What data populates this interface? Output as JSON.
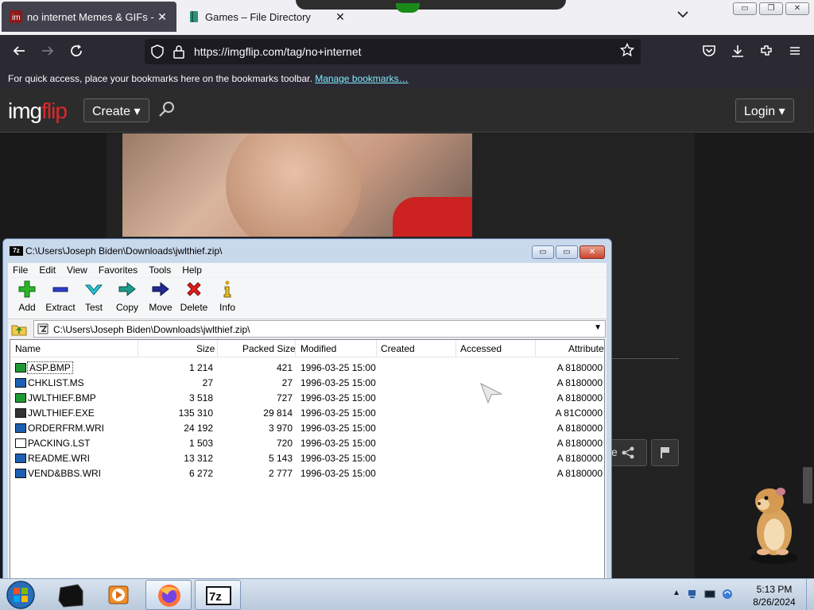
{
  "browser": {
    "tabs": [
      {
        "label": "no internet Memes & GIFs - Im",
        "close": "✕"
      },
      {
        "label": "Games – File Directory",
        "close": "✕"
      }
    ],
    "window_controls": {
      "minimize": "▭",
      "maximize": "❐",
      "close": "✕"
    },
    "url": "https://imgflip.com/tag/no+internet",
    "bookmarks_message": "For quick access, place your bookmarks here on the bookmarks toolbar.",
    "bookmarks_link": "Manage bookmarks…",
    "icons": [
      "back-icon",
      "forward-icon",
      "reload-icon",
      "shield-icon",
      "lock-icon",
      "star-icon",
      "pocket-icon",
      "download-icon",
      "extensions-icon",
      "menu-icon",
      "tab-list-chevron-icon"
    ]
  },
  "site": {
    "logo_white": "img",
    "logo_red": "flip",
    "create_label": "Create ▾",
    "login_label": "Login ▾",
    "share_partial": "e"
  },
  "zip": {
    "title": "C:\\Users\\Joseph Biden\\Downloads\\jwlthief.zip\\",
    "title_icon": "7z",
    "controls": {
      "minimize": "▭",
      "maximize": "▭",
      "close": "✕"
    },
    "menu": [
      "File",
      "Edit",
      "View",
      "Favorites",
      "Tools",
      "Help"
    ],
    "toolbar": [
      "Add",
      "Extract",
      "Test",
      "Copy",
      "Move",
      "Delete",
      "Info"
    ],
    "address": "C:\\Users\\Joseph Biden\\Downloads\\jwlthief.zip\\",
    "columns": [
      "Name",
      "Size",
      "Packed Size",
      "Modified",
      "Created",
      "Accessed",
      "Attribute"
    ],
    "files": [
      {
        "name": "ASP.BMP",
        "size": "1 214",
        "packed": "421",
        "modified": "1996-03-25 15:00",
        "attr": "A 8180000",
        "icon": "bitmap-file-icon"
      },
      {
        "name": "CHKLIST.MS",
        "size": "27",
        "packed": "27",
        "modified": "1996-03-25 15:00",
        "attr": "A 8180000",
        "icon": "generic-file-icon"
      },
      {
        "name": "JWLTHIEF.BMP",
        "size": "3 518",
        "packed": "727",
        "modified": "1996-03-25 15:00",
        "attr": "A 8180000",
        "icon": "bitmap-file-icon"
      },
      {
        "name": "JWLTHIEF.EXE",
        "size": "135 310",
        "packed": "29 814",
        "modified": "1996-03-25 15:00",
        "attr": "A 81C0000",
        "icon": "executable-file-icon"
      },
      {
        "name": "ORDERFRM.WRI",
        "size": "24 192",
        "packed": "3 970",
        "modified": "1996-03-25 15:00",
        "attr": "A 8180000",
        "icon": "write-file-icon"
      },
      {
        "name": "PACKING.LST",
        "size": "1 503",
        "packed": "720",
        "modified": "1996-03-25 15:00",
        "attr": "A 8180000",
        "icon": "text-file-icon"
      },
      {
        "name": "README.WRI",
        "size": "13 312",
        "packed": "5 143",
        "modified": "1996-03-25 15:00",
        "attr": "A 8180000",
        "icon": "write-file-icon"
      },
      {
        "name": "VEND&BBS.WRI",
        "size": "6 272",
        "packed": "2 777",
        "modified": "1996-03-25 15:00",
        "attr": "A 8180000",
        "icon": "write-file-icon"
      }
    ],
    "selected": "ASP.BMP"
  },
  "taskbar": {
    "time": "5:13 PM",
    "date": "8/26/2024",
    "items": [
      "start-orb-icon",
      "black-cube-icon",
      "media-player-icon",
      "firefox-icon",
      "seven-zip-icon"
    ],
    "active": [
      "firefox-icon",
      "seven-zip-icon"
    ]
  }
}
